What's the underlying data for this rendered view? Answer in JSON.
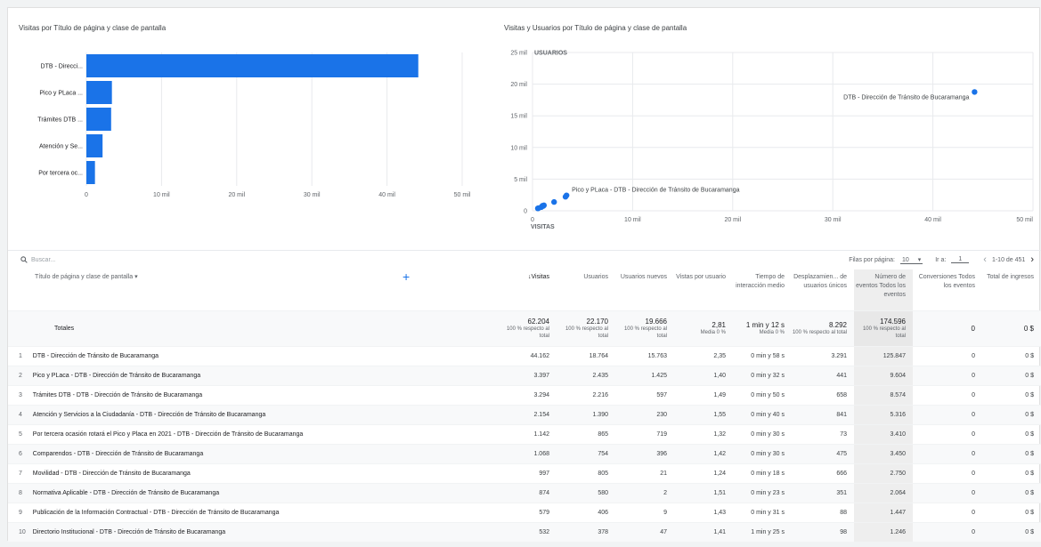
{
  "charts": {
    "bar_title": "Visitas por Título de página y clase de pantalla",
    "scatter_title": "Visitas y Usuarios por Título de página y clase de pantalla"
  },
  "chart_data": [
    {
      "type": "bar",
      "orientation": "horizontal",
      "title": "Visitas por Título de página y clase de pantalla",
      "categories": [
        "DTB - Direcci...",
        "Pico y PLaca ...",
        "Trámites DTB ...",
        "Atención y Se...",
        "Por tercera oc..."
      ],
      "values": [
        44162,
        3397,
        3294,
        2154,
        1142
      ],
      "xticks": [
        "0",
        "10 mil",
        "20 mil",
        "30 mil",
        "40 mil",
        "50 mil"
      ],
      "xlim": [
        0,
        50000
      ],
      "color": "#1a73e8"
    },
    {
      "type": "scatter",
      "title": "Visitas y Usuarios por Título de página y clase de pantalla",
      "xlabel": "VISITAS",
      "ylabel": "USUARIOS",
      "xticks": [
        "0",
        "10 mil",
        "20 mil",
        "30 mil",
        "40 mil",
        "50 mil"
      ],
      "yticks": [
        "25 mil",
        "20 mil",
        "15 mil",
        "10 mil",
        "5 mil",
        "0"
      ],
      "xlim": [
        0,
        50000
      ],
      "ylim": [
        0,
        25000
      ],
      "points": [
        {
          "x": 44162,
          "y": 18764,
          "label": "DTB - Dirección de Tránsito de Bucaramanga"
        },
        {
          "x": 3397,
          "y": 2435,
          "label": "Pico y PLaca - DTB - Dirección de Tránsito de Bucaramanga"
        },
        {
          "x": 3294,
          "y": 2216
        },
        {
          "x": 2154,
          "y": 1390
        },
        {
          "x": 1142,
          "y": 865
        },
        {
          "x": 1068,
          "y": 754
        },
        {
          "x": 997,
          "y": 805
        },
        {
          "x": 874,
          "y": 580
        },
        {
          "x": 579,
          "y": 406
        },
        {
          "x": 532,
          "y": 378
        }
      ],
      "color": "#1a73e8"
    }
  ],
  "toolbar": {
    "search_placeholder": "Buscar...",
    "rows_label": "Filas por página:",
    "rows_value": "10",
    "goto_label": "Ir a:",
    "goto_value": "1",
    "range": "1-10 de 451"
  },
  "table": {
    "headers": {
      "name": "Título de página y clase de pantalla",
      "visitas": "Visitas",
      "usuarios": "Usuarios",
      "nuevos": "Usuarios nuevos",
      "vpu": "Vistas por usuario",
      "tiempo": "Tiempo de interacción medio",
      "desp": "Desplazamien... de usuarios únicos",
      "eventos": "Número de eventos Todos los eventos",
      "conv": "Conversiones Todos los eventos",
      "ingresos": "Total de ingresos"
    },
    "totals": {
      "label": "Totales",
      "visitas": "62.204",
      "visitas_sub": "100 % respecto al total",
      "usuarios": "22.170",
      "usuarios_sub": "100 % respecto al total",
      "nuevos": "19.666",
      "nuevos_sub": "100 % respecto al total",
      "vpu": "2,81",
      "vpu_sub": "Media 0 %",
      "tiempo": "1 min y 12 s",
      "tiempo_sub": "Media 0 %",
      "desp": "8.292",
      "desp_sub": "100 % respecto al total",
      "eventos": "174.596",
      "eventos_sub": "100 % respecto al total",
      "conv": "0",
      "ingresos": "0 $"
    },
    "rows": [
      {
        "i": "1",
        "name": "DTB - Dirección de Tránsito de Bucaramanga",
        "visitas": "44.162",
        "usuarios": "18.764",
        "nuevos": "15.763",
        "vpu": "2,35",
        "tiempo": "0 min y 58 s",
        "desp": "3.291",
        "eventos": "125.847",
        "conv": "0",
        "ingresos": "0 $"
      },
      {
        "i": "2",
        "name": "Pico y PLaca - DTB - Dirección de Tránsito de Bucaramanga",
        "visitas": "3.397",
        "usuarios": "2.435",
        "nuevos": "1.425",
        "vpu": "1,40",
        "tiempo": "0 min y 32 s",
        "desp": "441",
        "eventos": "9.604",
        "conv": "0",
        "ingresos": "0 $"
      },
      {
        "i": "3",
        "name": "Trámites DTB - DTB - Dirección de Tránsito de Bucaramanga",
        "visitas": "3.294",
        "usuarios": "2.216",
        "nuevos": "597",
        "vpu": "1,49",
        "tiempo": "0 min y 50 s",
        "desp": "658",
        "eventos": "8.574",
        "conv": "0",
        "ingresos": "0 $"
      },
      {
        "i": "4",
        "name": "Atención y Servicios a la Ciudadanía - DTB - Dirección de Tránsito de Bucaramanga",
        "visitas": "2.154",
        "usuarios": "1.390",
        "nuevos": "230",
        "vpu": "1,55",
        "tiempo": "0 min y 40 s",
        "desp": "841",
        "eventos": "5.316",
        "conv": "0",
        "ingresos": "0 $"
      },
      {
        "i": "5",
        "name": "Por tercera ocasión rotará el Pico y Placa en 2021 - DTB - Dirección de Tránsito de Bucaramanga",
        "visitas": "1.142",
        "usuarios": "865",
        "nuevos": "719",
        "vpu": "1,32",
        "tiempo": "0 min y 30 s",
        "desp": "73",
        "eventos": "3.410",
        "conv": "0",
        "ingresos": "0 $"
      },
      {
        "i": "6",
        "name": "Comparendos - DTB - Dirección de Tránsito de Bucaramanga",
        "visitas": "1.068",
        "usuarios": "754",
        "nuevos": "396",
        "vpu": "1,42",
        "tiempo": "0 min y 30 s",
        "desp": "475",
        "eventos": "3.450",
        "conv": "0",
        "ingresos": "0 $"
      },
      {
        "i": "7",
        "name": "Movilidad - DTB - Dirección de Tránsito de Bucaramanga",
        "visitas": "997",
        "usuarios": "805",
        "nuevos": "21",
        "vpu": "1,24",
        "tiempo": "0 min y 18 s",
        "desp": "666",
        "eventos": "2.750",
        "conv": "0",
        "ingresos": "0 $"
      },
      {
        "i": "8",
        "name": "Normativa Aplicable - DTB - Dirección de Tránsito de Bucaramanga",
        "visitas": "874",
        "usuarios": "580",
        "nuevos": "2",
        "vpu": "1,51",
        "tiempo": "0 min y 23 s",
        "desp": "351",
        "eventos": "2.064",
        "conv": "0",
        "ingresos": "0 $"
      },
      {
        "i": "9",
        "name": "Publicación de la Información Contractual - DTB - Dirección de Tránsito de Bucaramanga",
        "visitas": "579",
        "usuarios": "406",
        "nuevos": "9",
        "vpu": "1,43",
        "tiempo": "0 min y 31 s",
        "desp": "88",
        "eventos": "1.447",
        "conv": "0",
        "ingresos": "0 $"
      },
      {
        "i": "10",
        "name": "Directorio Institucional - DTB - Dirección de Tránsito de Bucaramanga",
        "visitas": "532",
        "usuarios": "378",
        "nuevos": "47",
        "vpu": "1,41",
        "tiempo": "1 min y 25 s",
        "desp": "98",
        "eventos": "1.246",
        "conv": "0",
        "ingresos": "0 $"
      }
    ]
  }
}
